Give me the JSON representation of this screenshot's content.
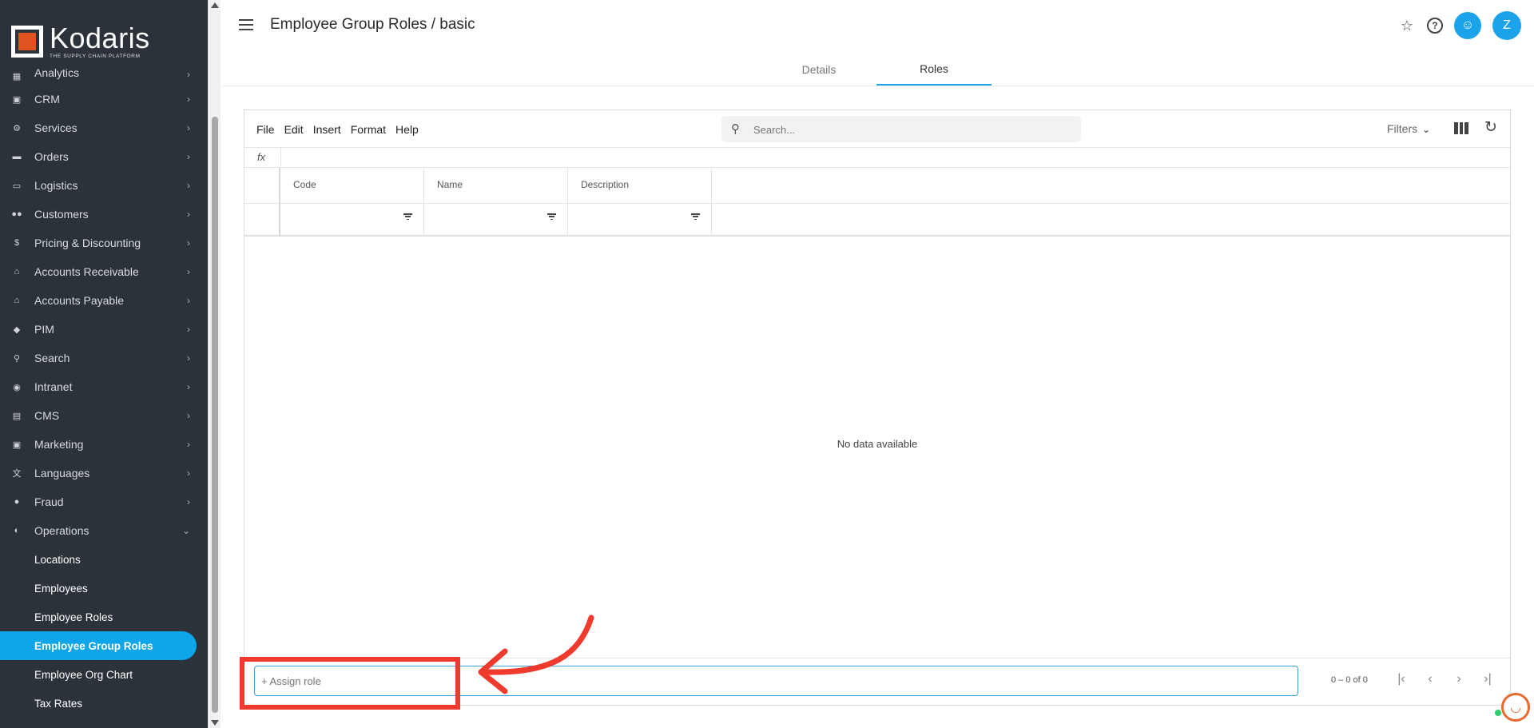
{
  "brand": {
    "name": "Kodaris",
    "tagline": "THE SUPPLY CHAIN PLATFORM",
    "accent": "#0ea5e9",
    "logo_orange": "#e0531f"
  },
  "sidebar": {
    "items": [
      {
        "label": "Analytics",
        "icon": "analytics-icon"
      },
      {
        "label": "CRM",
        "icon": "crm-icon"
      },
      {
        "label": "Services",
        "icon": "services-icon"
      },
      {
        "label": "Orders",
        "icon": "truck-icon"
      },
      {
        "label": "Logistics",
        "icon": "logistics-icon"
      },
      {
        "label": "Customers",
        "icon": "people-icon"
      },
      {
        "label": "Pricing & Discounting",
        "icon": "dollar-icon"
      },
      {
        "label": "Accounts Receivable",
        "icon": "bank-icon"
      },
      {
        "label": "Accounts Payable",
        "icon": "bank-icon"
      },
      {
        "label": "PIM",
        "icon": "tag-icon"
      },
      {
        "label": "Search",
        "icon": "search-icon"
      },
      {
        "label": "Intranet",
        "icon": "intranet-icon"
      },
      {
        "label": "CMS",
        "icon": "cms-icon"
      },
      {
        "label": "Marketing",
        "icon": "marketing-icon"
      },
      {
        "label": "Languages",
        "icon": "translate-icon"
      },
      {
        "label": "Fraud",
        "icon": "alert-icon"
      },
      {
        "label": "Operations",
        "icon": "operations-icon"
      }
    ],
    "operations_sub": [
      {
        "label": "Locations"
      },
      {
        "label": "Employees"
      },
      {
        "label": "Employee Roles"
      },
      {
        "label": "Employee Group Roles"
      },
      {
        "label": "Employee Org Chart"
      },
      {
        "label": "Tax Rates"
      }
    ]
  },
  "header": {
    "title": "Employee Group Roles / basic",
    "avatar_initial": "Z"
  },
  "tabs": [
    {
      "label": "Details"
    },
    {
      "label": "Roles"
    }
  ],
  "toolbar": {
    "menus": [
      "File",
      "Edit",
      "Insert",
      "Format",
      "Help"
    ],
    "search_placeholder": "Search...",
    "filters_label": "Filters",
    "fx_label": "fx"
  },
  "grid": {
    "columns": [
      "Code",
      "Name",
      "Description"
    ],
    "empty_text": "No data available"
  },
  "footer": {
    "assign_placeholder": "+ Assign role",
    "pager_text": "0 – 0 of 0"
  }
}
